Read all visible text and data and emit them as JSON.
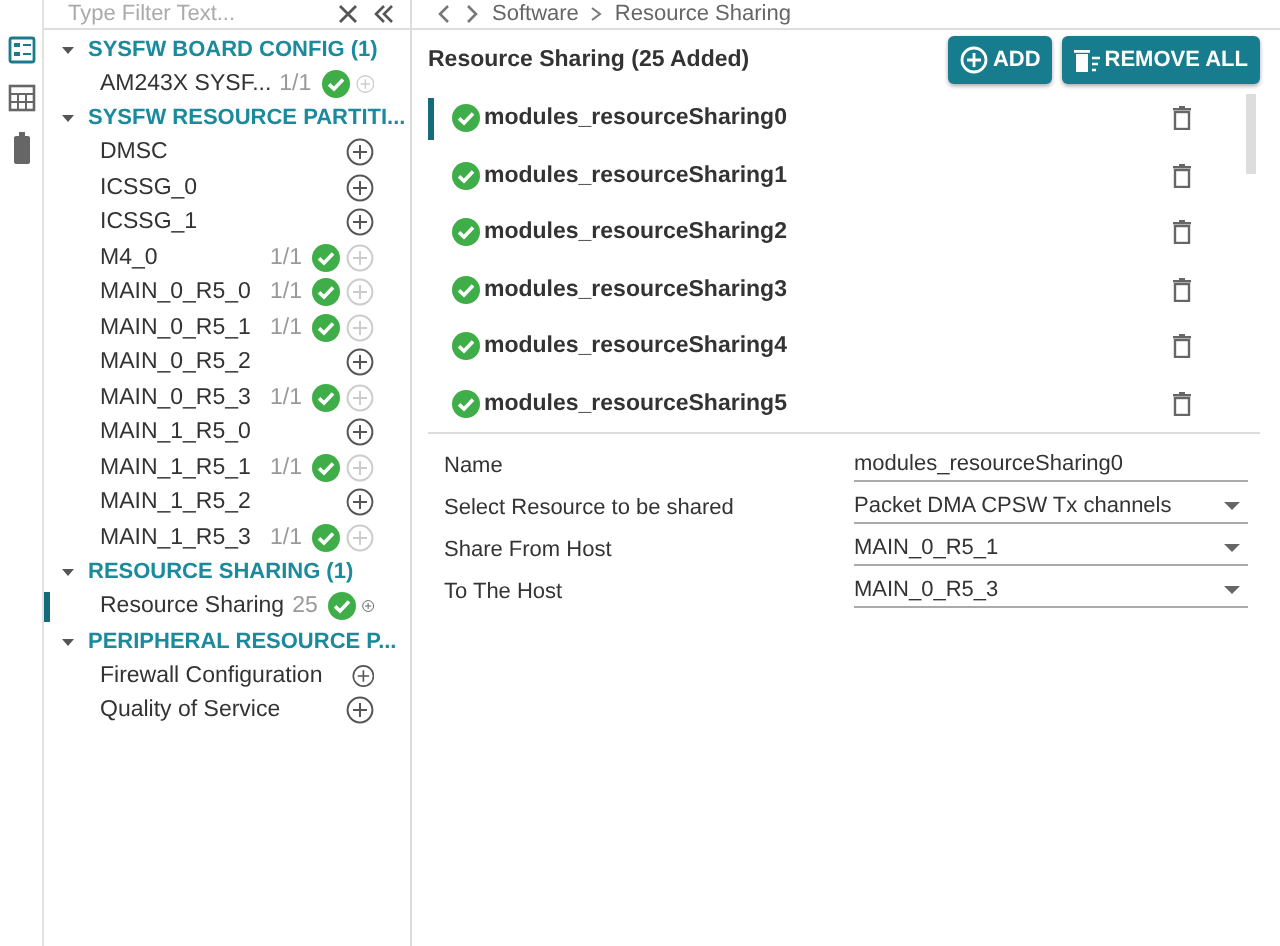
{
  "filter": {
    "placeholder": "Type Filter Text..."
  },
  "rail": [
    {
      "kind": "board",
      "selected": true
    },
    {
      "kind": "calc",
      "selected": false
    },
    {
      "kind": "battery",
      "selected": false
    }
  ],
  "tree": [
    {
      "label": "SYSFW BOARD CONFIG (1)",
      "expanded": true,
      "items": [
        {
          "label": "AM243X SYSF...",
          "count": "1/1",
          "valid": true,
          "add_disabled": true,
          "selected": false
        }
      ]
    },
    {
      "label": "SYSFW RESOURCE PARTITI...",
      "expanded": true,
      "items": [
        {
          "label": "DMSC",
          "valid": false,
          "add_disabled": false,
          "selected": false
        },
        {
          "label": "ICSSG_0",
          "valid": false,
          "add_disabled": false,
          "selected": false
        },
        {
          "label": "ICSSG_1",
          "valid": false,
          "add_disabled": false,
          "selected": false
        },
        {
          "label": "M4_0",
          "count": "1/1",
          "valid": true,
          "add_disabled": true,
          "selected": false
        },
        {
          "label": "MAIN_0_R5_0",
          "count": "1/1",
          "valid": true,
          "add_disabled": true,
          "selected": false
        },
        {
          "label": "MAIN_0_R5_1",
          "count": "1/1",
          "valid": true,
          "add_disabled": true,
          "selected": false
        },
        {
          "label": "MAIN_0_R5_2",
          "valid": false,
          "add_disabled": false,
          "selected": false
        },
        {
          "label": "MAIN_0_R5_3",
          "count": "1/1",
          "valid": true,
          "add_disabled": true,
          "selected": false
        },
        {
          "label": "MAIN_1_R5_0",
          "valid": false,
          "add_disabled": false,
          "selected": false
        },
        {
          "label": "MAIN_1_R5_1",
          "count": "1/1",
          "valid": true,
          "add_disabled": true,
          "selected": false
        },
        {
          "label": "MAIN_1_R5_2",
          "valid": false,
          "add_disabled": false,
          "selected": false
        },
        {
          "label": "MAIN_1_R5_3",
          "count": "1/1",
          "valid": true,
          "add_disabled": true,
          "selected": false
        }
      ]
    },
    {
      "label": "RESOURCE SHARING (1)",
      "expanded": true,
      "items": [
        {
          "label": "Resource Sharing",
          "count": "25",
          "valid": true,
          "add_disabled": false,
          "selected": true
        }
      ]
    },
    {
      "label": "PERIPHERAL RESOURCE P...",
      "expanded": true,
      "items": [
        {
          "label": "Firewall Configuration",
          "valid": false,
          "add_disabled": false,
          "selected": false
        },
        {
          "label": "Quality of Service",
          "valid": false,
          "add_disabled": false,
          "selected": false
        }
      ]
    }
  ],
  "breadcrumb": [
    "Software",
    "Resource Sharing"
  ],
  "header": {
    "title": "Resource Sharing (25 Added)",
    "add": "ADD",
    "remove_all": "REMOVE ALL"
  },
  "instances": [
    {
      "name": "modules_resourceSharing0",
      "valid": true,
      "selected": true
    },
    {
      "name": "modules_resourceSharing1",
      "valid": true,
      "selected": false
    },
    {
      "name": "modules_resourceSharing2",
      "valid": true,
      "selected": false
    },
    {
      "name": "modules_resourceSharing3",
      "valid": true,
      "selected": false
    },
    {
      "name": "modules_resourceSharing4",
      "valid": true,
      "selected": false
    },
    {
      "name": "modules_resourceSharing5",
      "valid": true,
      "selected": false
    }
  ],
  "fields": [
    {
      "label": "Name",
      "kind": "text",
      "value": "modules_resourceSharing0"
    },
    {
      "label": "Select Resource to be shared",
      "kind": "select",
      "value": "Packet DMA CPSW Tx channels"
    },
    {
      "label": "Share From Host",
      "kind": "select",
      "value": "MAIN_0_R5_1"
    },
    {
      "label": "To The Host",
      "kind": "select",
      "value": "MAIN_0_R5_3"
    }
  ]
}
